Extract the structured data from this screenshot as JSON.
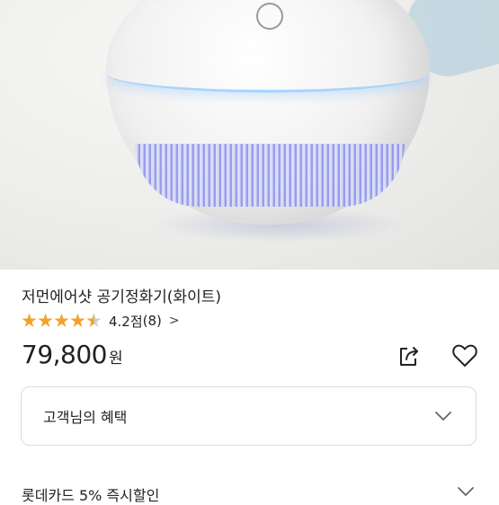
{
  "product": {
    "title": "저먼에어샷 공기정화기(화이트)",
    "rating": {
      "stars": 4.5,
      "max_stars": 5,
      "score_text": "4.2점",
      "review_count_text": "(8)",
      "chevron": ">"
    },
    "price": {
      "value": "79,800",
      "unit": "원"
    }
  },
  "actions": {
    "share_icon": "share-icon",
    "wishlist_icon": "heart-icon"
  },
  "benefits": {
    "label": "고객님의 혜택",
    "expand_icon": "chevron-down-icon"
  },
  "promo": {
    "text": "롯데카드 5% 즉시할인"
  },
  "colors": {
    "star": "#f2a22a",
    "text": "#222222",
    "border": "#dcdcdc"
  }
}
